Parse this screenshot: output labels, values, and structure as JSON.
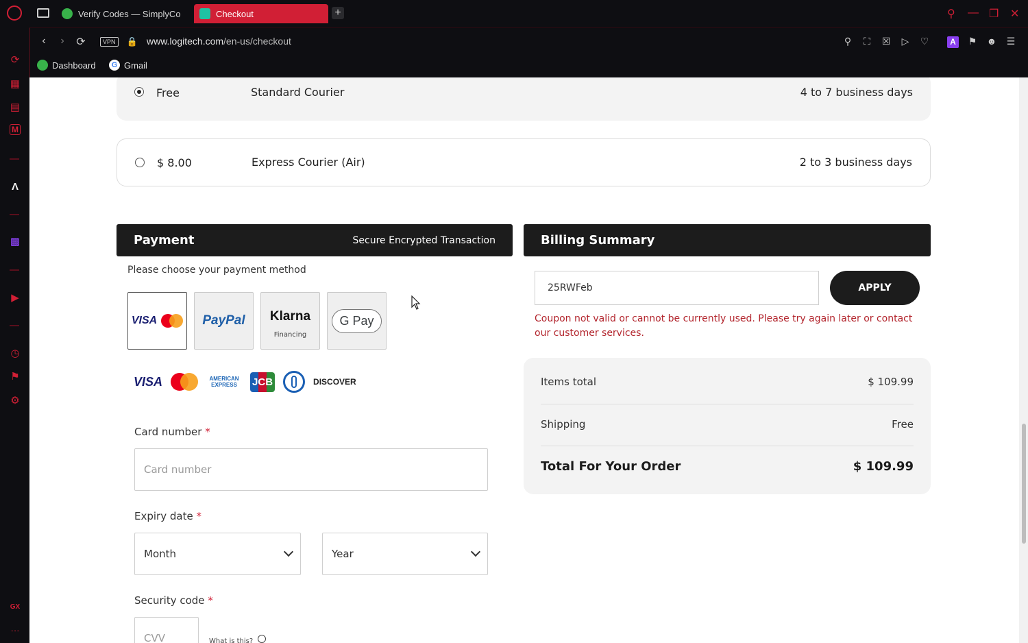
{
  "browser": {
    "tabs": [
      {
        "label": "Verify Codes — SimplyCo",
        "active": false
      },
      {
        "label": "Checkout",
        "active": true
      }
    ],
    "new_tab": "+",
    "url": {
      "domain": "www.logitech.com",
      "path": "/en-us/checkout"
    },
    "vpn_badge": "VPN",
    "bookmarks": [
      {
        "label": "Dashboard"
      },
      {
        "label": "Gmail"
      }
    ],
    "gx_label": "GX",
    "more_label": "···",
    "ext_letter": "A"
  },
  "shipping": {
    "options": [
      {
        "price": "Free",
        "name": "Standard Courier",
        "days": "4 to 7 business days",
        "selected": true
      },
      {
        "price": "$ 8.00",
        "name": "Express Courier (Air)",
        "days": "2 to 3 business days",
        "selected": false
      }
    ]
  },
  "payment": {
    "title": "Payment",
    "secure_text": "Secure Encrypted Transaction",
    "hint": "Please choose your payment method",
    "methods": [
      {
        "name": "card",
        "visa": "VISA"
      },
      {
        "name": "paypal",
        "label": "PayPal"
      },
      {
        "name": "klarna",
        "label": "Klarna",
        "sub": "Financing"
      },
      {
        "name": "gpay",
        "label": "G Pay"
      }
    ],
    "accepted_cards": [
      "VISA",
      "Mastercard",
      "AMERICAN EXPRESS",
      "JCB",
      "Diners Club",
      "DISCOVER"
    ],
    "card_number_label": "Card number",
    "card_number_placeholder": "Card number",
    "expiry_label": "Expiry date",
    "month_value": "Month",
    "year_value": "Year",
    "security_label": "Security code",
    "cvv_placeholder": "CVV",
    "what_is_this": "What is this?",
    "required_mark": "*"
  },
  "billing": {
    "title": "Billing Summary",
    "coupon_value": "25RWFeb",
    "apply_label": "APPLY",
    "coupon_error": "Coupon not valid or cannot be currently used. Please try again later or contact our customer services.",
    "items_total_label": "Items total",
    "items_total_value": "$ 109.99",
    "shipping_label": "Shipping",
    "shipping_value": "Free",
    "total_label": "Total For Your Order",
    "total_value": "$ 109.99"
  },
  "colors": {
    "accent": "#d11f35",
    "panel": "#1c1c1c",
    "error": "#b3262e"
  }
}
